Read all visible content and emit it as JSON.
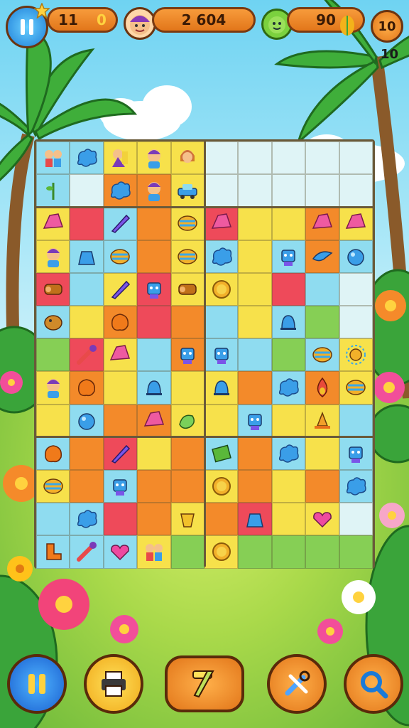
{
  "hud": {
    "left_counter": "0",
    "left_counter_prefix": "11",
    "score": "2 604",
    "gems": "90",
    "level": "10",
    "level_sub": "10"
  },
  "colors": {
    "yellow": "#f7e14b",
    "orange": "#f38a2a",
    "red": "#ee4a5a",
    "cyan": "#8fdcf0",
    "green": "#86cf55",
    "lime": "#d6ec5a",
    "empty": "#dff4f6"
  },
  "board": {
    "columns": 10,
    "rows": 13,
    "tiles": [
      [
        "cyan:people",
        "cyan:splash",
        "yellow:lady",
        "yellow:boy",
        "yellow:girl",
        "empty",
        "empty",
        "empty",
        "empty",
        "empty"
      ],
      [
        "cyan:plant",
        "empty",
        "orange:splash",
        "orange:boy",
        "yellow:car",
        "empty",
        "empty",
        "empty",
        "empty",
        "empty"
      ],
      [
        "yellow:gem",
        "red:",
        "cyan:pencil",
        "orange:",
        "yellow:shell",
        "red:gem",
        "yellow:",
        "yellow:",
        "orange:gem",
        "yellow:gem"
      ],
      [
        "yellow:boy",
        "cyan:bag",
        "cyan:shell",
        "orange:",
        "yellow:shell",
        "cyan:splash",
        "yellow:",
        "cyan:robot",
        "orange:bird",
        "cyan:orb"
      ],
      [
        "red:log",
        "cyan:",
        "yellow:pencil",
        "red:robot",
        "yellow:log",
        "yellow:coin",
        "yellow:",
        "red:",
        "cyan:",
        ""
      ],
      [
        "cyan:dog",
        "yellow:",
        "orange:blob",
        "red:",
        "orange:",
        "cyan:",
        "yellow:",
        "cyan:bell",
        "green:",
        ""
      ],
      [
        "green:",
        "red:tool",
        "yellow:gem",
        "cyan:",
        "orange:robot",
        "cyan:robot",
        "cyan:",
        "green:",
        "cyan:shell",
        "yellow:sun"
      ],
      [
        "yellow:boy",
        "orange:blob",
        "yellow:",
        "cyan:bell",
        "yellow:",
        "yellow:bell",
        "orange:",
        "cyan:splash",
        "orange:drop",
        "yellow:shell"
      ],
      [
        "yellow:",
        "cyan:orb",
        "orange:",
        "orange:gem",
        "yellow:pepper",
        "yellow:",
        "cyan:robot",
        "yellow:",
        "yellow:cone",
        "cyan:"
      ],
      [
        "cyan:blob",
        "orange:",
        "red:pencil",
        "yellow:",
        "orange:",
        "cyan:block",
        "orange:",
        "cyan:splash",
        "yellow:",
        "cyan:robot"
      ],
      [
        "yellow:shell",
        "orange:",
        "cyan:robot",
        "orange:",
        "orange:",
        "yellow:coin",
        "orange:",
        "yellow:",
        "orange:",
        "cyan:splash"
      ],
      [
        "cyan:",
        "cyan:splash",
        "red:",
        "orange:",
        "yellow:cup",
        "orange:",
        "red:bag",
        "yellow:",
        "yellow:heart",
        ""
      ],
      [
        "cyan:boot",
        "cyan:tool",
        "cyan:heart",
        "yellow:people",
        "green:",
        "yellow:coin",
        "green:",
        "green:",
        "green:",
        "green:"
      ]
    ]
  },
  "bottom": {
    "buttons": [
      "pause",
      "printer",
      "brush",
      "tools",
      "search"
    ]
  }
}
